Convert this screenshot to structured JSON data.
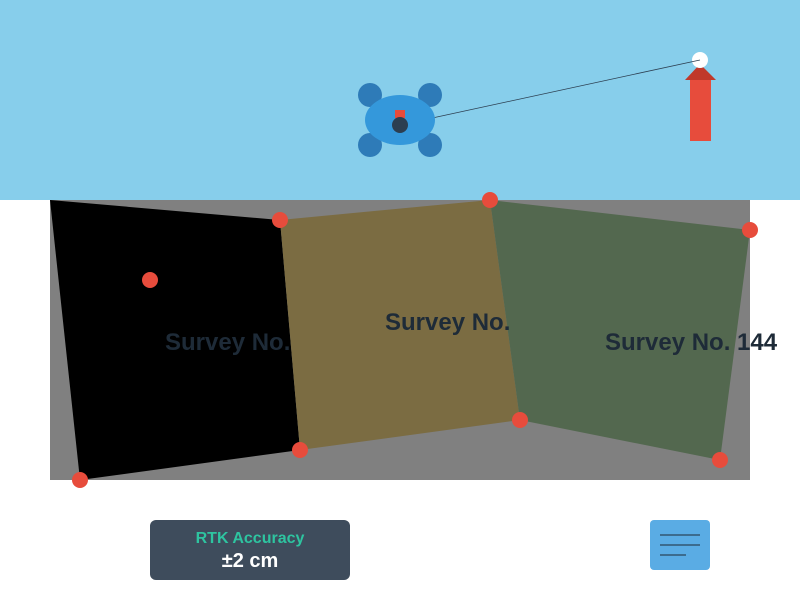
{
  "parcels": [
    {
      "label": "Survey No.",
      "fill": "#000000",
      "text_color": "#1e2b38"
    },
    {
      "label": "Survey No.",
      "fill": "#7b6c42",
      "text_color": "#1e2b38"
    },
    {
      "label": "Survey No. 144",
      "fill": "#53684f",
      "text_color": "#1e2b38"
    }
  ],
  "colors": {
    "sky": "#87ceeb",
    "ground": "#808080",
    "survey_point": "#e74c3c",
    "drone_body": "#3498db",
    "drone_rotor": "#2e7bb8",
    "base_station": "#e74c3c"
  },
  "icons": {
    "drone": "drone-icon",
    "base_station": "base-station-icon",
    "menu": "menu-lines-icon"
  },
  "status": {
    "label": "RTK Accuracy",
    "value": "±2 cm"
  }
}
